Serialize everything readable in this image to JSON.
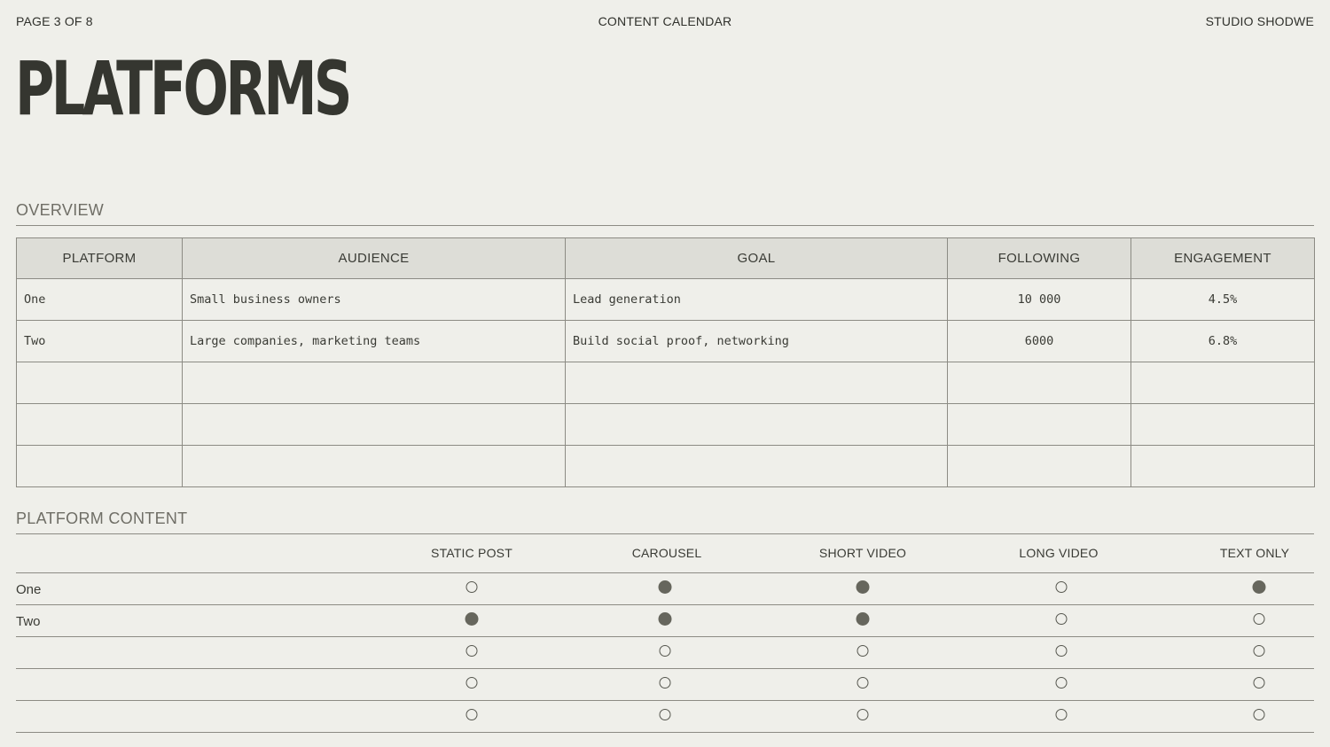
{
  "header": {
    "page_indicator": "PAGE 3 OF 8",
    "center_title": "CONTENT CALENDAR",
    "brand": "STUDIO SHODWE"
  },
  "title": "PLATFORMS",
  "overview": {
    "heading": "OVERVIEW",
    "columns": [
      "PLATFORM",
      "AUDIENCE",
      "GOAL",
      "FOLLOWING",
      "ENGAGEMENT"
    ],
    "rows": [
      [
        "One",
        "Small business owners",
        "Lead generation",
        "10 000",
        "4.5%"
      ],
      [
        "Two",
        "Large companies, marketing teams",
        "Build social proof, networking",
        "6000",
        "6.8%"
      ],
      [
        "",
        "",
        "",
        "",
        ""
      ],
      [
        "",
        "",
        "",
        "",
        ""
      ],
      [
        "",
        "",
        "",
        "",
        ""
      ]
    ]
  },
  "platform_content": {
    "heading": "PLATFORM CONTENT",
    "columns": [
      "STATIC POST",
      "CAROUSEL",
      "SHORT VIDEO",
      "LONG VIDEO",
      "TEXT ONLY"
    ],
    "rows": [
      {
        "label": "One",
        "checks": [
          false,
          true,
          true,
          false,
          true
        ]
      },
      {
        "label": "Two",
        "checks": [
          true,
          true,
          true,
          false,
          false
        ]
      },
      {
        "label": "",
        "checks": [
          false,
          false,
          false,
          false,
          false
        ]
      },
      {
        "label": "",
        "checks": [
          false,
          false,
          false,
          false,
          false
        ]
      },
      {
        "label": "",
        "checks": [
          false,
          false,
          false,
          false,
          false
        ]
      }
    ]
  },
  "colors": {
    "background": "#efefea",
    "header_fill": "#ddddd7",
    "filled_dot": "#66665d",
    "text": "#3a3b35"
  }
}
